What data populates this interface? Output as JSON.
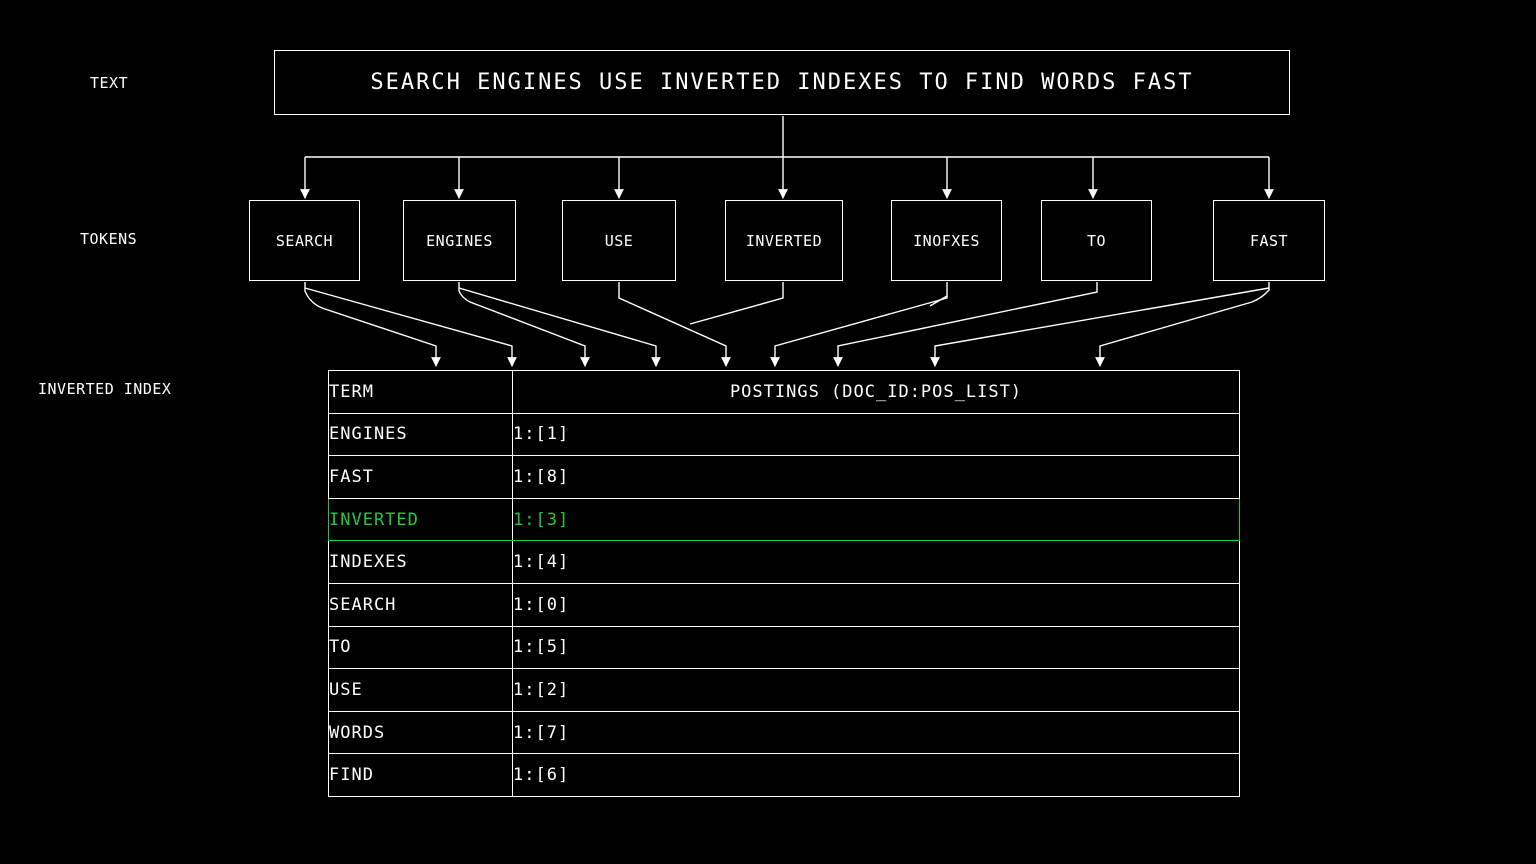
{
  "labels": {
    "text": "TEXT",
    "tokens": "TOKENS",
    "inverted_index": "INVERTED INDEX"
  },
  "sentence": "SEARCH ENGINES USE INVERTED INDEXES TO FIND WORDS FAST",
  "tokens": [
    "SEARCH",
    "ENGINES",
    "USE",
    "INVERTED",
    "INOFXES",
    "TO",
    "FAST"
  ],
  "table": {
    "headers": {
      "term": "TERM",
      "postings": "POSTINGS (DOC_ID:POS_LIST)"
    },
    "rows": [
      {
        "term": "ENGINES",
        "postings": "1:[1]"
      },
      {
        "term": "FAST",
        "postings": "1:[8]"
      },
      {
        "term": "INVERTED",
        "postings": "1:[3]"
      },
      {
        "term": "INDEXES",
        "postings": "1:[4]"
      },
      {
        "term": "SEARCH",
        "postings": "1:[0]"
      },
      {
        "term": "TO",
        "postings": "1:[5]"
      },
      {
        "term": "USE",
        "postings": "1:[2]"
      },
      {
        "term": "WORDS",
        "postings": "1:[7]"
      },
      {
        "term": "FIND",
        "postings": "1:[6]"
      }
    ],
    "highlight_row": 2
  },
  "colors": {
    "background": "#000000",
    "foreground": "#ffffff",
    "highlight": "#22c83a"
  }
}
